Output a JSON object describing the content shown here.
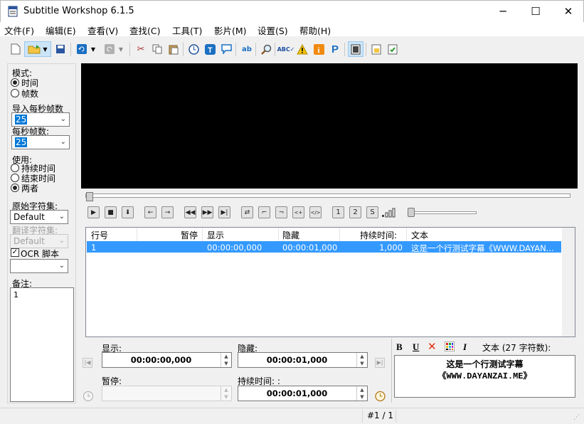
{
  "window": {
    "title": "Subtitle Workshop 6.1.5",
    "minimize": "─",
    "maximize": "☐",
    "close": "✕"
  },
  "menu": [
    "文件(F)",
    "编辑(E)",
    "查看(V)",
    "查找(C)",
    "工具(T)",
    "影片(M)",
    "设置(S)",
    "帮助(H)"
  ],
  "left": {
    "mode_label": "模式:",
    "mode_time": "时间",
    "mode_frames": "帧数",
    "import_fps_label": "导入每秒帧数",
    "import_fps_value": "25",
    "fps_label": "每秒帧数:",
    "fps_value": "25",
    "apply_label": "使用:",
    "apply_duration": "持续时间",
    "apply_end": "结束时间",
    "apply_both": "两者",
    "orig_charset_label": "原始字符集:",
    "orig_charset_value": "Default",
    "trans_charset_label": "翻译字符集:",
    "trans_charset_value": "Default",
    "ocr_label": "OCR 脚本",
    "notes_label": "备注:",
    "notes_value": "1"
  },
  "grid": {
    "headers": {
      "num": "行号",
      "pause": "暂停",
      "show": "显示",
      "hide": "隐藏",
      "duration": "持续时间:",
      "text": "文本"
    },
    "rows": [
      {
        "num": "1",
        "pause": "",
        "show": "00:00:00,000",
        "hide": "00:00:01,000",
        "duration": "1,000",
        "text": "这是一个行测试字幕《WWW.DAYAN..."
      }
    ]
  },
  "editor": {
    "show_label": "显示:",
    "show_value": "00:00:00,000",
    "hide_label": "隐藏:",
    "hide_value": "00:00:01,000",
    "pause_label": "暂停:",
    "pause_value": "",
    "duration_label": "持续时间: :",
    "duration_value": "00:00:01,000",
    "text_label": "文本 (27 字符数):",
    "text_line1": "这是一个行测试字幕",
    "text_line2": "《WWW.DAYANZAI.ME》",
    "bold": "B",
    "underline": "U",
    "italic": "I"
  },
  "status": {
    "position": "#1 / 1"
  },
  "colors": {
    "selection": "#3399ff",
    "video_bg": "#000000",
    "accent_blue": "#0066cc"
  }
}
